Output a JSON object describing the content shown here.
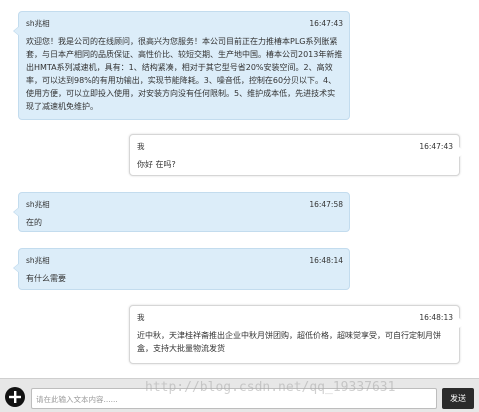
{
  "messages": [
    {
      "sender": "sh兆相",
      "time": "16:47:43",
      "text": "欢迎您！我是公司的在线顾问，很高兴为您服务！本公司目前正在力推椿本PLG系列胀紧套，与日本产相同的品质保证、高性价比、较短交期、生产地中国。椿本公司2013年新推出HMTA系列减速机，具有：1、结构紧凑，相对于其它型号省20%安装空间。2、高效率，可以达到98%的有用功输出，实现节能降耗。3、噪音低，控制在60分贝以下。4、使用方便，可以立即投入使用，对安装方向没有任何限制。5、维护成本低，先进技术实现了减速机免维护。"
    },
    {
      "sender": "我",
      "time": "16:47:43",
      "text": "你好 在吗?"
    },
    {
      "sender": "sh兆相",
      "time": "16:47:58",
      "text": "在的"
    },
    {
      "sender": "sh兆相",
      "time": "16:48:14",
      "text": "有什么需要"
    },
    {
      "sender": "我",
      "time": "16:48:13",
      "text": "近中秋，天津桂祥斋推出企业中秋月饼团购，超低价格，超味觉享受，可自行定制月饼盒，支持大批量物流发货"
    }
  ],
  "input": {
    "placeholder": "请在此输入文本内容......"
  },
  "send_label": "发送",
  "watermark": "http://blog.csdn.net/qq_19337631",
  "icons": {
    "add": "plus-circle-icon"
  }
}
